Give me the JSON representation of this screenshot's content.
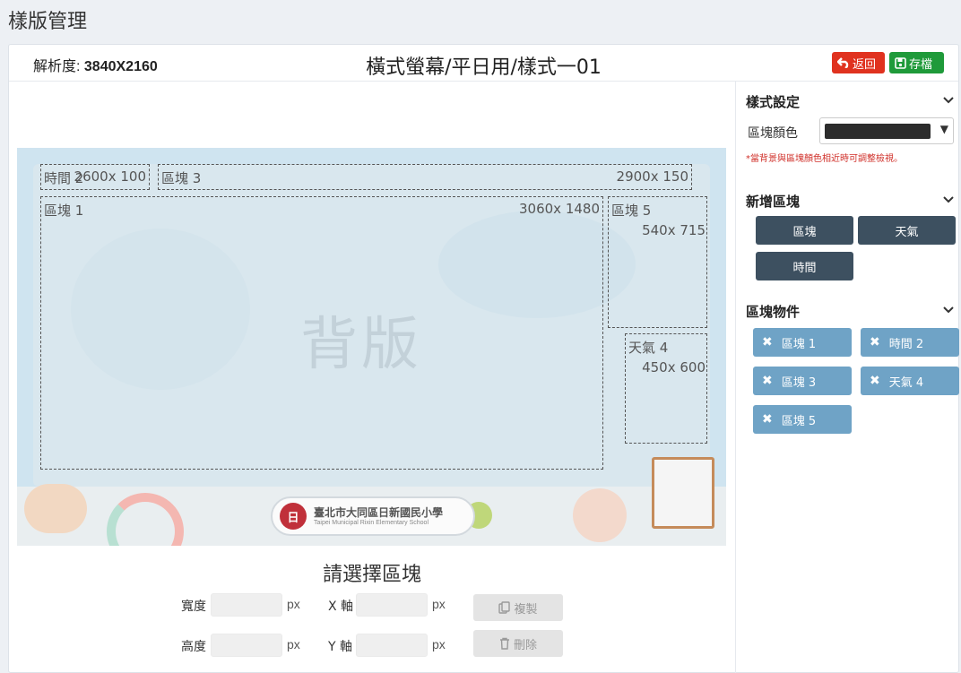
{
  "page": {
    "title": "樣版管理"
  },
  "header": {
    "resolution_label": "解析度:",
    "resolution_value": "3840X2160",
    "layout_name": "橫式螢幕/平日用/樣式一01",
    "back_label": "返回",
    "save_label": "存檔"
  },
  "canvas": {
    "background_word": "背版",
    "school_logo_text": "日",
    "school_name": "臺北市大同區日新國民小學",
    "school_name_en": "Taipei Municipal Rixin Elementary School",
    "blocks": [
      {
        "name": "時間 2",
        "size": "2600x 100"
      },
      {
        "name": "區塊 3",
        "size": "2900x 150"
      },
      {
        "name": "區塊 1",
        "size": "3060x 1480"
      },
      {
        "name": "區塊 5",
        "size": "540x 715"
      },
      {
        "name": "天氣 4",
        "size": "450x 600"
      }
    ]
  },
  "editor": {
    "hint": "請選擇區塊",
    "width_label": "寬度",
    "height_label": "高度",
    "x_label": "X 軸",
    "y_label": "Y 軸",
    "unit": "px",
    "copy_label": "複製",
    "delete_label": "刪除"
  },
  "sidebar": {
    "style_title": "樣式設定",
    "block_color_label": "區塊顏色",
    "block_color_value": "#2c2c2c",
    "caret": "▼",
    "warning": "*當背景與區塊顏色相近時可調整檢視。",
    "add_title": "新增區塊",
    "add_buttons": [
      "區塊",
      "天氣",
      "時間"
    ],
    "objects_title": "區塊物件",
    "objects": [
      "區塊 1",
      "時間 2",
      "區塊 3",
      "天氣 4",
      "區塊 5"
    ],
    "remove_glyph": "✖"
  },
  "colors": {
    "back": "#e0321f",
    "save": "#1f9a3a",
    "add_button": "#3d5060",
    "chip": "#6fa3c6",
    "warning": "#d0302a"
  }
}
